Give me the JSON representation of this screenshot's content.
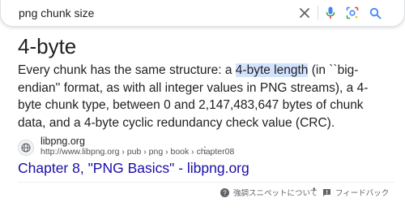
{
  "search": {
    "query": "png chunk size"
  },
  "result": {
    "heading": "4-byte",
    "snippet_before": "Every chunk has the same structure: a ",
    "snippet_highlight": "4-byte length",
    "snippet_after": " (in ``big-endian'' format, as with all integer values in PNG streams), a 4-byte chunk type, between 0 and 2,147,483,647 bytes of chunk data, and a 4-byte cyclic redundancy check value (CRC).",
    "site_name": "libpng.org",
    "site_url": "http://www.libpng.org › pub › png › book › chapter08",
    "link_text": "Chapter 8, \"PNG Basics\" - libpng.org"
  },
  "footer": {
    "about_label": "強調スニペットについて",
    "separator": "•",
    "feedback_label": "フィードバック"
  },
  "colors": {
    "link": "#1a0dab",
    "highlight": "#d3e3fd",
    "mic_blue": "#4285f4"
  },
  "icons": [
    "close-icon",
    "microphone-icon",
    "lens-icon",
    "search-icon",
    "globe-icon",
    "more-vert-icon",
    "help-icon",
    "feedback-icon"
  ]
}
